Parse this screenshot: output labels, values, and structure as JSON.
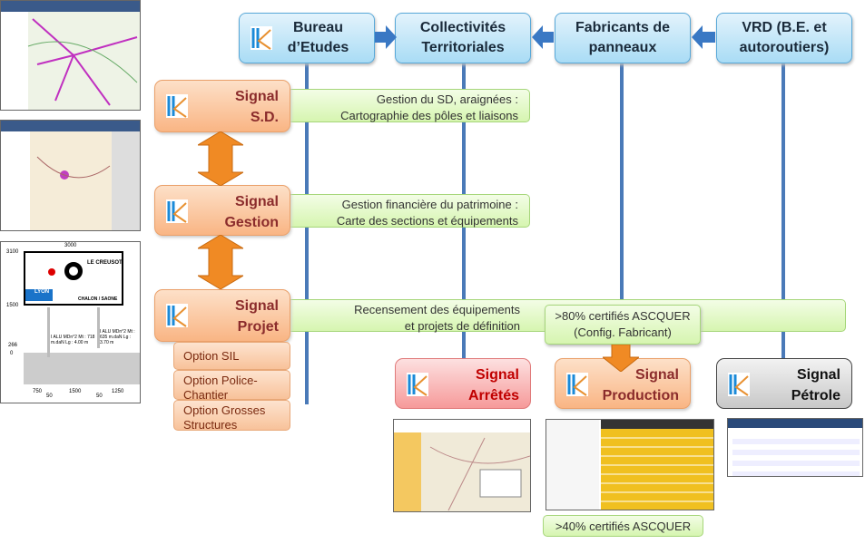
{
  "actors": [
    {
      "label_l1": "Bureau",
      "label_l2": "d’Etudes"
    },
    {
      "label_l1": "Collectivités",
      "label_l2": "Territoriales"
    },
    {
      "label_l1": "Fabricants de",
      "label_l2": "panneaux"
    },
    {
      "label_l1": "VRD (B.E. et",
      "label_l2": "autoroutiers)"
    }
  ],
  "modules": {
    "sd": {
      "l1": "Signal",
      "l2": "S.D.",
      "desc1": "Gestion du SD, araignées :",
      "desc2": "Cartographie des pôles et liaisons"
    },
    "gestion": {
      "l1": "Signal",
      "l2": "Gestion",
      "desc1": "Gestion financière du patrimoine :",
      "desc2": "Carte des sections et équipements"
    },
    "projet": {
      "l1": "Signal",
      "l2": "Projet",
      "desc1": "Recensement des équipements",
      "desc2": "et projets de définition"
    },
    "arretes": {
      "l1": "Signal",
      "l2": "Arrêtés"
    },
    "production": {
      "l1": "Signal",
      "l2": "Production"
    },
    "petrole": {
      "l1": "Signal",
      "l2": "Pétrole"
    }
  },
  "options": [
    "Option SIL",
    "Option Police-Chantier",
    "Option Grosses Structures"
  ],
  "callouts": {
    "fab1": ">80%  certifiés ASCQUER",
    "fab2": "(Config. Fabricant)",
    "bottom": ">40% certifiés ASCQUER"
  },
  "sign_drawing": {
    "width": "3000",
    "h1": "3100",
    "h2": "1500",
    "h3": "266",
    "h4": "0",
    "dest1": "LE CREUSOT",
    "dest2": "LYON",
    "dest3": "CHALON / SAONE",
    "post1": "I ALU MDn°2  Mt : 718 m.daN  Lg : 4.00 m",
    "post2": "I ALU MDn°2  Mt : 635 m.daN  Lg : 3.70 m",
    "d1": "750",
    "d2": "1500",
    "d3": "1250",
    "d4": "50",
    "d5": "50"
  },
  "colors": {
    "actor_border": "#58a8d8",
    "module_orange": "#f9b584",
    "timeline_blue": "#4a7ab8",
    "desc_green": "#d6f5b0"
  }
}
